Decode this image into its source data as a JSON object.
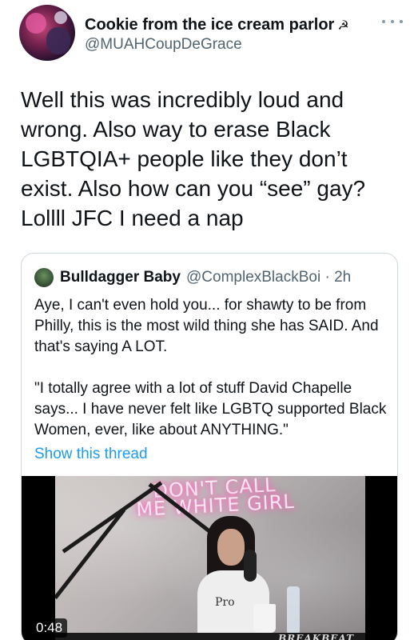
{
  "tweet": {
    "display_name": "Cookie from the ice cream parlor",
    "name_icons": "☭ ☭",
    "handle": "@MUAHCoupDeGrace",
    "text": "Well this was incredibly loud and wrong. Also way to erase Black LGBTQIA+ people like they don’t exist. Also how can you “see” gay? Lollll JFC I need a nap",
    "more_icon": "more-horizontal-icon"
  },
  "quote": {
    "display_name": "Bulldagger Baby",
    "handle_time": "@ComplexBlackBoi · 2h",
    "text": "Aye, I can't even hold you... for shawty to be from Philly, this is the most wild thing she has SAID. And that's saying A LOT.\n\n\"I totally agree with a lot of stuff David Chapelle says... I have never felt like LGBTQ supported Black Women, ever, like about ANYTHING.\"",
    "show_thread": "Show this thread",
    "video": {
      "neon_sign": "DON'T CALL ME WHITE GIRL",
      "shirt_print": "Pro",
      "brand": "BREAKBEAT",
      "time": "0:48"
    }
  },
  "colors": {
    "text": "#0f1419",
    "secondary": "#536471",
    "link": "#1d9bf0",
    "border": "#cfd9de"
  }
}
